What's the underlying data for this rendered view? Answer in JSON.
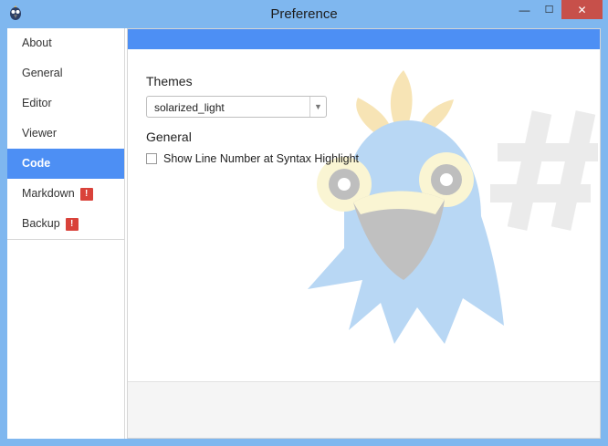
{
  "window": {
    "title": "Preference",
    "controls": {
      "minimize": "—",
      "maximize": "☐",
      "close": "✕"
    }
  },
  "sidebar": {
    "items": [
      {
        "label": "About"
      },
      {
        "label": "General"
      },
      {
        "label": "Editor"
      },
      {
        "label": "Viewer"
      },
      {
        "label": "Code",
        "active": true
      },
      {
        "label": "Markdown",
        "badge": "!"
      },
      {
        "label": "Backup",
        "badge": "!"
      }
    ]
  },
  "content": {
    "themes": {
      "label": "Themes",
      "selected": "solarized_light"
    },
    "general": {
      "label": "General",
      "show_line_number": {
        "label": "Show Line Number at Syntax Highlight",
        "checked": false
      }
    }
  },
  "icons": {
    "app": "mascot-bird-icon",
    "dropdown": "chevron-down-icon"
  },
  "colors": {
    "accent": "#4d8ff4",
    "frame": "#7fb7ef",
    "badge": "#d9423a",
    "close": "#c7504a"
  }
}
